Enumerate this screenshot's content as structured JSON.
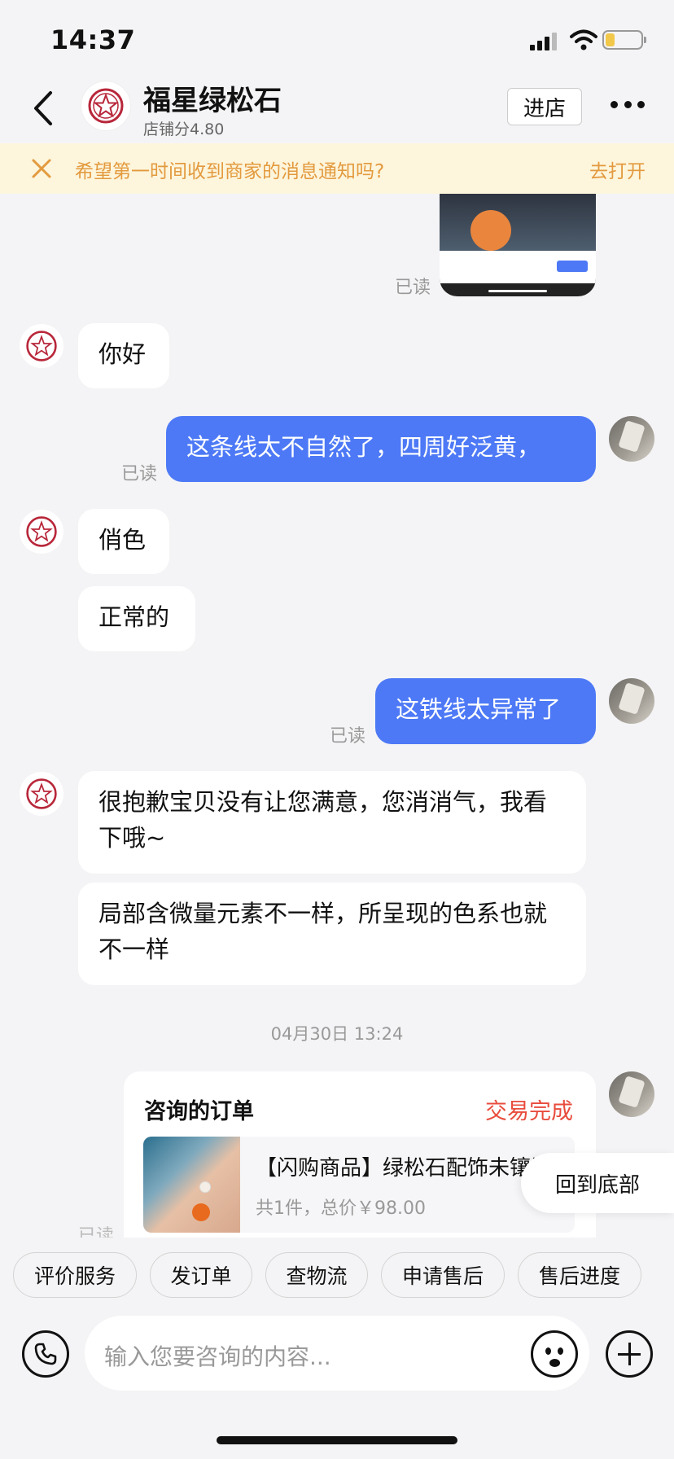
{
  "status_bar": {
    "time": "14:37"
  },
  "header": {
    "shop_name": "福星绿松石",
    "shop_score": "店铺分4.80",
    "enter_label": "进店"
  },
  "notify": {
    "text": "希望第一时间收到商家的消息通知吗?",
    "action": "去打开"
  },
  "messages": [
    {
      "from": "user",
      "type": "image",
      "read": "已读"
    },
    {
      "from": "shop",
      "text": "你好"
    },
    {
      "from": "user",
      "text": "这条线太不自然了，四周好泛黄，",
      "read": "已读"
    },
    {
      "from": "shop",
      "text": "俏色"
    },
    {
      "from": "shop",
      "text": "正常的"
    },
    {
      "from": "user",
      "text": "这铁线太异常了",
      "read": "已读"
    },
    {
      "from": "shop",
      "text": "很抱歉宝贝没有让您满意，您消消气，我看下哦~"
    },
    {
      "from": "shop",
      "text": "局部含微量元素不一样，所呈现的色系也就不一样"
    }
  ],
  "date_separator": "04月30日 13:24",
  "order_card": {
    "title": "咨询的订单",
    "status": "交易完成",
    "product_name": "【闪购商品】绿松石配饰未镶嵌",
    "summary": "共1件，总价￥98.00",
    "read": "已读"
  },
  "back_to_bottom": "回到底部",
  "quick_actions": [
    "评价服务",
    "发订单",
    "查物流",
    "申请售后",
    "售后进度"
  ],
  "input": {
    "placeholder": "输入您要咨询的内容..."
  },
  "icons": {
    "back": "chevron-left-icon",
    "more": "more-dots-icon",
    "close": "close-icon",
    "phone": "phone-icon",
    "emoji": "emoji-icon",
    "plus": "plus-icon"
  },
  "colors": {
    "accent_blue": "#4d79f6",
    "banner_bg": "#fdf5dc",
    "banner_text": "#e39a3e",
    "status_red": "#e84c3d"
  }
}
